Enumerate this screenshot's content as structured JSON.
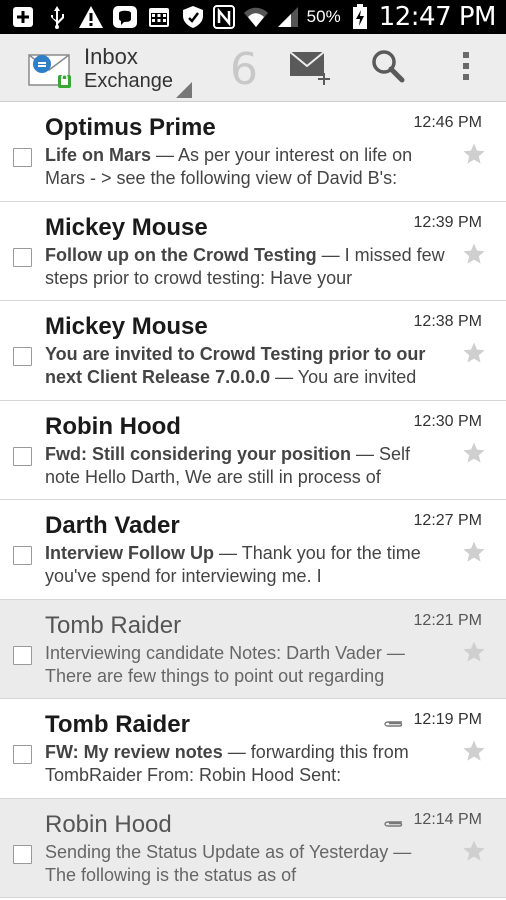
{
  "status_bar": {
    "battery_percent": "50%",
    "clock": "12:47 PM",
    "left_icons": [
      "add-box-icon",
      "usb-icon",
      "warning-icon",
      "chat-app-icon",
      "calendar-icon",
      "shield-icon"
    ],
    "right_icons": [
      "nfc-icon",
      "wifi-icon",
      "signal-icon",
      "battery-charging-icon"
    ]
  },
  "action_bar": {
    "title": "Inbox",
    "account": "Exchange",
    "unread_count": "6",
    "buttons": [
      {
        "name": "compose-button",
        "icon": "compose-mail-icon"
      },
      {
        "name": "search-button",
        "icon": "search-icon"
      },
      {
        "name": "overflow-menu-button",
        "icon": "more-vert-icon"
      }
    ]
  },
  "messages": [
    {
      "sender": "Optimus Prime",
      "time": "12:46 PM",
      "subject": "Life on Mars",
      "snippet": " — As per your interest on life on Mars - > see the following view of David B's:",
      "read": false,
      "attachment": false
    },
    {
      "sender": "Mickey Mouse",
      "time": "12:39 PM",
      "subject": "Follow up on the Crowd Testing",
      "snippet": " — I missed few steps prior to crowd testing: Have your",
      "read": false,
      "attachment": false
    },
    {
      "sender": "Mickey Mouse",
      "time": "12:38 PM",
      "subject": "You are invited to Crowd Testing prior to our next Client Release 7.0.0.0",
      "snippet": " — You are invited",
      "read": false,
      "attachment": false
    },
    {
      "sender": "Robin Hood",
      "time": "12:30 PM",
      "subject": "Fwd: Still considering your position",
      "snippet": " — Self note Hello Darth, We are still in process of",
      "read": false,
      "attachment": false
    },
    {
      "sender": "Darth Vader",
      "time": "12:27 PM",
      "subject": "Interview Follow Up",
      "snippet": " — Thank you for the time you've spend for interviewing me. I",
      "read": false,
      "attachment": false
    },
    {
      "sender": "Tomb Raider",
      "time": "12:21 PM",
      "subject": "Interviewing candidate Notes: Darth Vader",
      "snippet": " — There are few things to point out regarding",
      "read": true,
      "attachment": false
    },
    {
      "sender": "Tomb Raider",
      "time": "12:19 PM",
      "subject": "FW: My review notes",
      "snippet": " — forwarding this from TombRaider From: Robin Hood Sent:",
      "read": false,
      "attachment": true
    },
    {
      "sender": "Robin Hood",
      "time": "12:14 PM",
      "subject": "Sending the Status Update as of Yesterday",
      "snippet": " — The following is the status as of",
      "read": true,
      "attachment": true
    }
  ],
  "colors": {
    "status_bar_bg": "#000000",
    "action_bar_bg": "#ededed",
    "read_row_bg": "#ebebeb",
    "unread_row_bg": "#ffffff",
    "unread_count": "#c8c8c8"
  }
}
